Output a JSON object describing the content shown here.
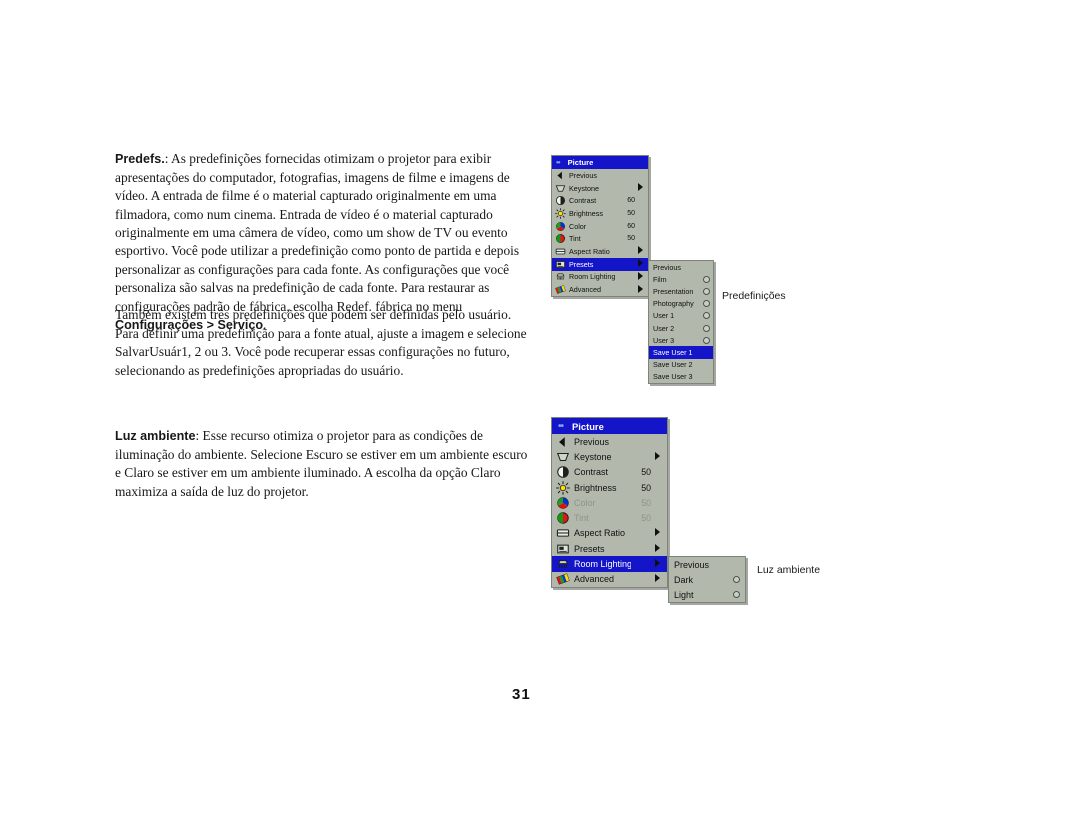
{
  "page": {
    "number": "31"
  },
  "body": {
    "paragraph_presets": {
      "lead": "Predefs.",
      "text": ": As predefinições fornecidas otimizam o projetor para exibir apresentações do computador, fotografias, imagens de filme e imagens de vídeo. A entrada de filme é o material capturado originalmente em uma filmadora, como num cinema. Entrada de vídeo é o material capturado originalmente em uma câmera de vídeo, como um show de TV ou evento esportivo. Você pode utilizar a predefinição como ponto de partida e depois personalizar as configurações para cada fonte. As configurações que você personaliza são salvas na predefinição de cada fonte. Para restaurar as configurações padrão de fábrica, escolha Redef. fábrica no menu ",
      "bold_tail": "Configurações > Serviço",
      "tail_end": "."
    },
    "paragraph_user_presets": {
      "text": "Também existem três predefinições que podem ser definidas pelo usuário. Para definir uma predefinição para a fonte atual, ajuste a imagem e selecione SalvarUsuár1, 2 ou 3. Você pode recuperar essas configurações no futuro, selecionando as predefinições apropriadas do usuário."
    },
    "paragraph_room_lighting": {
      "lead": "Luz ambiente",
      "text": ": Esse recurso otimiza o projetor para as condições de iluminação do ambiente. Selecione Escuro se estiver em um ambiente escuro e Claro se estiver em um ambiente iluminado. A escolha da opção Claro maximiza a saída de luz do projetor."
    }
  },
  "callouts": {
    "presets": "Predefinições",
    "room_lighting": "Luz ambiente"
  },
  "colors": {
    "menu_background": "#b2b8ac",
    "menu_border": "#7d8478",
    "highlight": "#1414c8",
    "highlight_text": "#ffffff",
    "disabled_text": "#8d9489",
    "title_dots": "#7ba6f5"
  },
  "menu_presets": {
    "title": "Picture",
    "title_icon": "dots-icon",
    "rows": [
      {
        "icon": "previous-arrow-icon",
        "label": "Previous",
        "value": "",
        "arrow": false,
        "selected": false,
        "disabled": false
      },
      {
        "icon": "keystone-icon",
        "label": "Keystone",
        "value": "",
        "arrow": true,
        "selected": false,
        "disabled": false
      },
      {
        "icon": "contrast-icon",
        "label": "Contrast",
        "value": "60",
        "arrow": false,
        "selected": false,
        "disabled": false
      },
      {
        "icon": "brightness-icon",
        "label": "Brightness",
        "value": "50",
        "arrow": false,
        "selected": false,
        "disabled": false
      },
      {
        "icon": "color-icon",
        "label": "Color",
        "value": "60",
        "arrow": false,
        "selected": false,
        "disabled": false
      },
      {
        "icon": "tint-icon",
        "label": "Tint",
        "value": "50",
        "arrow": false,
        "selected": false,
        "disabled": false
      },
      {
        "icon": "aspect-ratio-icon",
        "label": "Aspect Ratio",
        "value": "",
        "arrow": true,
        "selected": false,
        "disabled": false
      },
      {
        "icon": "presets-icon",
        "label": "Presets",
        "value": "",
        "arrow": true,
        "selected": true,
        "disabled": false
      },
      {
        "icon": "room-lighting-icon",
        "label": "Room Lighting",
        "value": "",
        "arrow": true,
        "selected": false,
        "disabled": false
      },
      {
        "icon": "advanced-icon",
        "label": "Advanced",
        "value": "",
        "arrow": true,
        "selected": false,
        "disabled": false
      }
    ]
  },
  "submenu_presets": {
    "rows": [
      {
        "label": "Previous",
        "radio": false,
        "selected": false
      },
      {
        "label": "Film",
        "radio": true,
        "selected": false
      },
      {
        "label": "Presentation",
        "radio": true,
        "selected": false
      },
      {
        "label": "Photography",
        "radio": true,
        "selected": false
      },
      {
        "label": "User 1",
        "radio": true,
        "selected": false
      },
      {
        "label": "User 2",
        "radio": true,
        "selected": false
      },
      {
        "label": "User 3",
        "radio": true,
        "selected": false
      },
      {
        "label": "Save User 1",
        "radio": false,
        "selected": true
      },
      {
        "label": "Save User 2",
        "radio": false,
        "selected": false
      },
      {
        "label": "Save User 3",
        "radio": false,
        "selected": false
      }
    ]
  },
  "menu_room_lighting": {
    "title": "Picture",
    "title_icon": "dots-icon",
    "rows": [
      {
        "icon": "previous-arrow-icon",
        "label": "Previous",
        "value": "",
        "arrow": false,
        "selected": false,
        "disabled": false
      },
      {
        "icon": "keystone-icon",
        "label": "Keystone",
        "value": "",
        "arrow": true,
        "selected": false,
        "disabled": false
      },
      {
        "icon": "contrast-icon",
        "label": "Contrast",
        "value": "50",
        "arrow": false,
        "selected": false,
        "disabled": false
      },
      {
        "icon": "brightness-icon",
        "label": "Brightness",
        "value": "50",
        "arrow": false,
        "selected": false,
        "disabled": false
      },
      {
        "icon": "color-icon",
        "label": "Color",
        "value": "50",
        "arrow": false,
        "selected": false,
        "disabled": true
      },
      {
        "icon": "tint-icon",
        "label": "Tint",
        "value": "50",
        "arrow": false,
        "selected": false,
        "disabled": true
      },
      {
        "icon": "aspect-ratio-icon",
        "label": "Aspect Ratio",
        "value": "",
        "arrow": true,
        "selected": false,
        "disabled": false
      },
      {
        "icon": "presets-icon",
        "label": "Presets",
        "value": "",
        "arrow": true,
        "selected": false,
        "disabled": false
      },
      {
        "icon": "room-lighting-icon",
        "label": "Room Lighting",
        "value": "",
        "arrow": true,
        "selected": true,
        "disabled": false
      },
      {
        "icon": "advanced-icon",
        "label": "Advanced",
        "value": "",
        "arrow": true,
        "selected": false,
        "disabled": false
      }
    ]
  },
  "submenu_room_lighting": {
    "rows": [
      {
        "label": "Previous",
        "radio": false,
        "selected": false
      },
      {
        "label": "Dark",
        "radio": true,
        "selected": false
      },
      {
        "label": "Light",
        "radio": true,
        "selected": false
      }
    ]
  }
}
